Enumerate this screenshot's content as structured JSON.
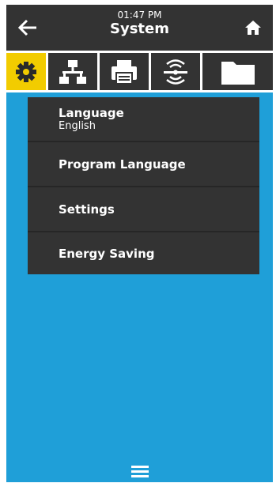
{
  "header": {
    "time": "01:47 PM",
    "title": "System"
  },
  "icons": {
    "back": "arrow-left-icon",
    "home": "home-icon",
    "tabs": [
      "gear-icon",
      "network-icon",
      "printer-icon",
      "wireless-icon",
      "folder-icon"
    ],
    "menu": "hamburger-icon"
  },
  "menu": {
    "items": [
      {
        "label": "Language",
        "value": "English"
      },
      {
        "label": "Program Language"
      },
      {
        "label": "Settings"
      },
      {
        "label": "Energy Saving"
      }
    ]
  },
  "colors": {
    "background": "#1f9fd8",
    "bar": "#333333",
    "active_tab": "#f2cc00"
  }
}
